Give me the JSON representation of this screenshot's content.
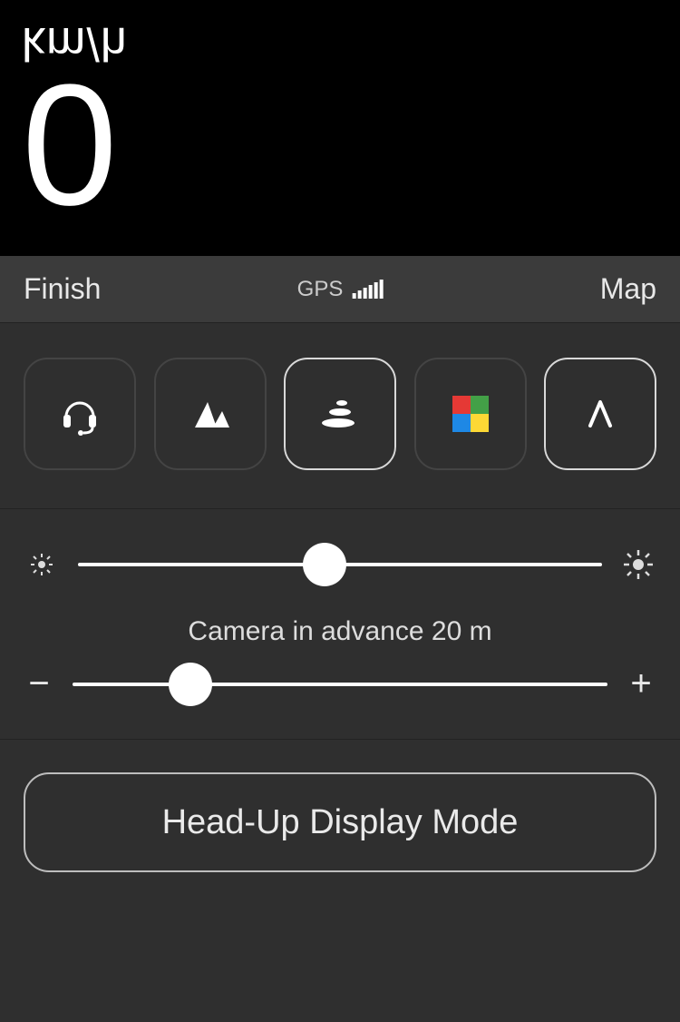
{
  "top": {
    "unit": "km/h",
    "speed": "0"
  },
  "bar": {
    "left": "Finish",
    "gps_label": "GPS",
    "right": "Map"
  },
  "modes": {
    "items": [
      {
        "name": "headset-icon",
        "active": false
      },
      {
        "name": "mountains-icon",
        "active": false
      },
      {
        "name": "stack-icon",
        "active": true
      },
      {
        "name": "colors-icon",
        "active": false
      },
      {
        "name": "caret-icon",
        "active": true
      }
    ]
  },
  "brightness": {
    "value_pct": 47
  },
  "camera_advance": {
    "label": "Camera in advance 20 m",
    "value_pct": 22
  },
  "hud_button": "Head-Up Display Mode"
}
